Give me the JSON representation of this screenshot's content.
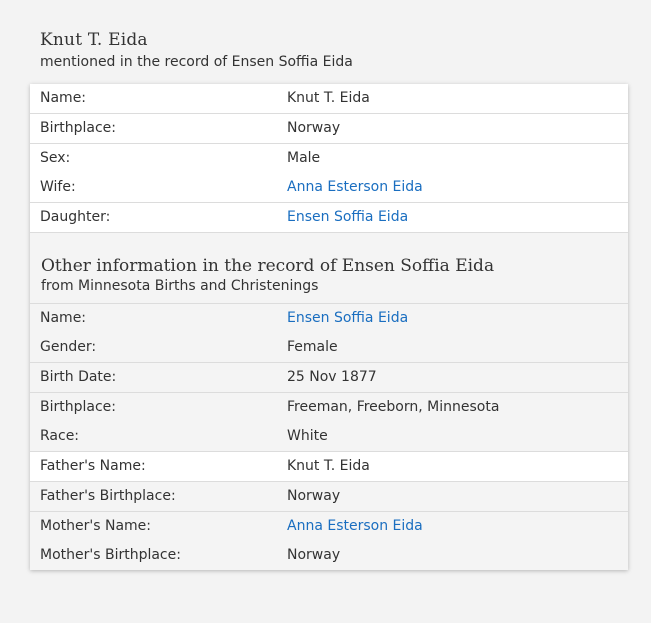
{
  "person": {
    "name": "Knut T. Eida",
    "mention": "mentioned in the record of Ensen Soffia Eida"
  },
  "primary_rows": [
    {
      "label": "Name:",
      "value": "Knut T. Eida",
      "link": false
    },
    {
      "label": "Birthplace:",
      "value": "Norway",
      "link": false
    },
    {
      "label": "Sex:",
      "value": "Male",
      "link": false
    },
    {
      "label": "Wife:",
      "value": "Anna Esterson Eida",
      "link": true
    },
    {
      "label": "Daughter:",
      "value": "Ensen Soffia Eida",
      "link": true
    }
  ],
  "other_section": {
    "title": "Other information in the record of Ensen Soffia Eida",
    "subtitle": "from Minnesota Births and Christenings"
  },
  "other_rows": [
    {
      "label": "Name:",
      "value": "Ensen Soffia Eida",
      "link": true
    },
    {
      "label": "Gender:",
      "value": "Female",
      "link": false
    },
    {
      "label": "Birth Date:",
      "value": "25 Nov 1877",
      "link": false
    },
    {
      "label": "Birthplace:",
      "value": "Freeman, Freeborn, Minnesota",
      "link": false
    },
    {
      "label": "Race:",
      "value": "White",
      "link": false
    },
    {
      "label": "Father's Name:",
      "value": "Knut T. Eida",
      "link": false
    },
    {
      "label": "Father's Birthplace:",
      "value": "Norway",
      "link": false
    },
    {
      "label": "Mother's Name:",
      "value": "Anna Esterson Eida",
      "link": true
    },
    {
      "label": "Mother's Birthplace:",
      "value": "Norway",
      "link": false
    }
  ],
  "colors": {
    "link": "#1a6ec0",
    "text": "#333333",
    "background": "#f3f3f3",
    "row_white": "#ffffff",
    "row_grey": "#f4f4f4"
  }
}
